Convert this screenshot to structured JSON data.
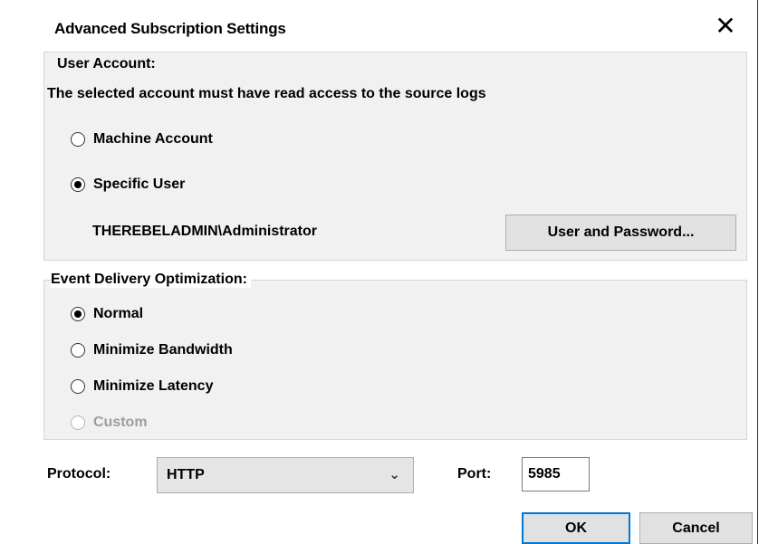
{
  "dialog": {
    "title": "Advanced Subscription Settings",
    "close_label": "✕"
  },
  "user_account": {
    "legend": "User Account:",
    "description": "The selected account must have read access to the source logs",
    "options": [
      {
        "label": "Machine Account",
        "checked": false,
        "disabled": false
      },
      {
        "label": "Specific User",
        "checked": true,
        "disabled": false
      }
    ],
    "account_name": "THEREBELADMIN\\Administrator",
    "user_password_button": "User and Password..."
  },
  "event_delivery": {
    "legend": "Event Delivery Optimization:",
    "options": [
      {
        "label": "Normal",
        "checked": true,
        "disabled": false
      },
      {
        "label": "Minimize Bandwidth",
        "checked": false,
        "disabled": false
      },
      {
        "label": "Minimize Latency",
        "checked": false,
        "disabled": false
      },
      {
        "label": "Custom",
        "checked": false,
        "disabled": true
      }
    ]
  },
  "protocol": {
    "label": "Protocol:",
    "value": "HTTP",
    "chevron_icon": "chevron-down-icon"
  },
  "port": {
    "label": "Port:",
    "value": "5985"
  },
  "buttons": {
    "ok": "OK",
    "cancel": "Cancel"
  }
}
